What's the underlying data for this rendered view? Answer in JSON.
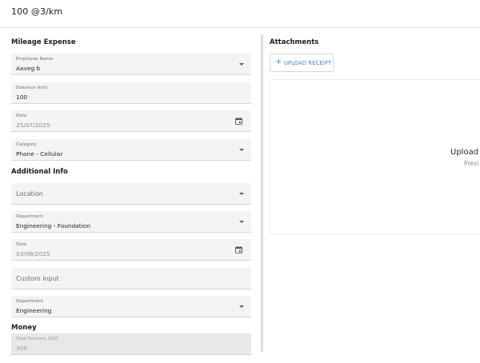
{
  "header": {
    "title": "100 @3/km"
  },
  "mileage": {
    "title": "Mileage Expense",
    "employee": {
      "label": "Employee Name",
      "value": "Aaveg b"
    },
    "distance": {
      "label": "Distance (km)",
      "value": "100"
    },
    "date": {
      "label": "Date",
      "value": "25/07/2025"
    },
    "category": {
      "label": "Category",
      "value": "Phone - Cellular"
    }
  },
  "additional": {
    "title": "Additional Info",
    "location": {
      "placeholder": "Location"
    },
    "department1": {
      "label": "Department",
      "value": "Engineering - Foundation"
    },
    "date": {
      "label": "Date",
      "value": "03/08/2025"
    },
    "custom_input": {
      "placeholder": "Custom Input"
    },
    "department2": {
      "label": "Department",
      "value": "Engineering"
    }
  },
  "money": {
    "title": "Money",
    "total": {
      "label": "Total Amount, SGD",
      "value": "300"
    }
  },
  "attachments": {
    "title": "Attachments",
    "upload_label": "UPLOAD RECEIPT",
    "dropzone_title": "Upload f",
    "dropzone_sub": "Previ"
  }
}
